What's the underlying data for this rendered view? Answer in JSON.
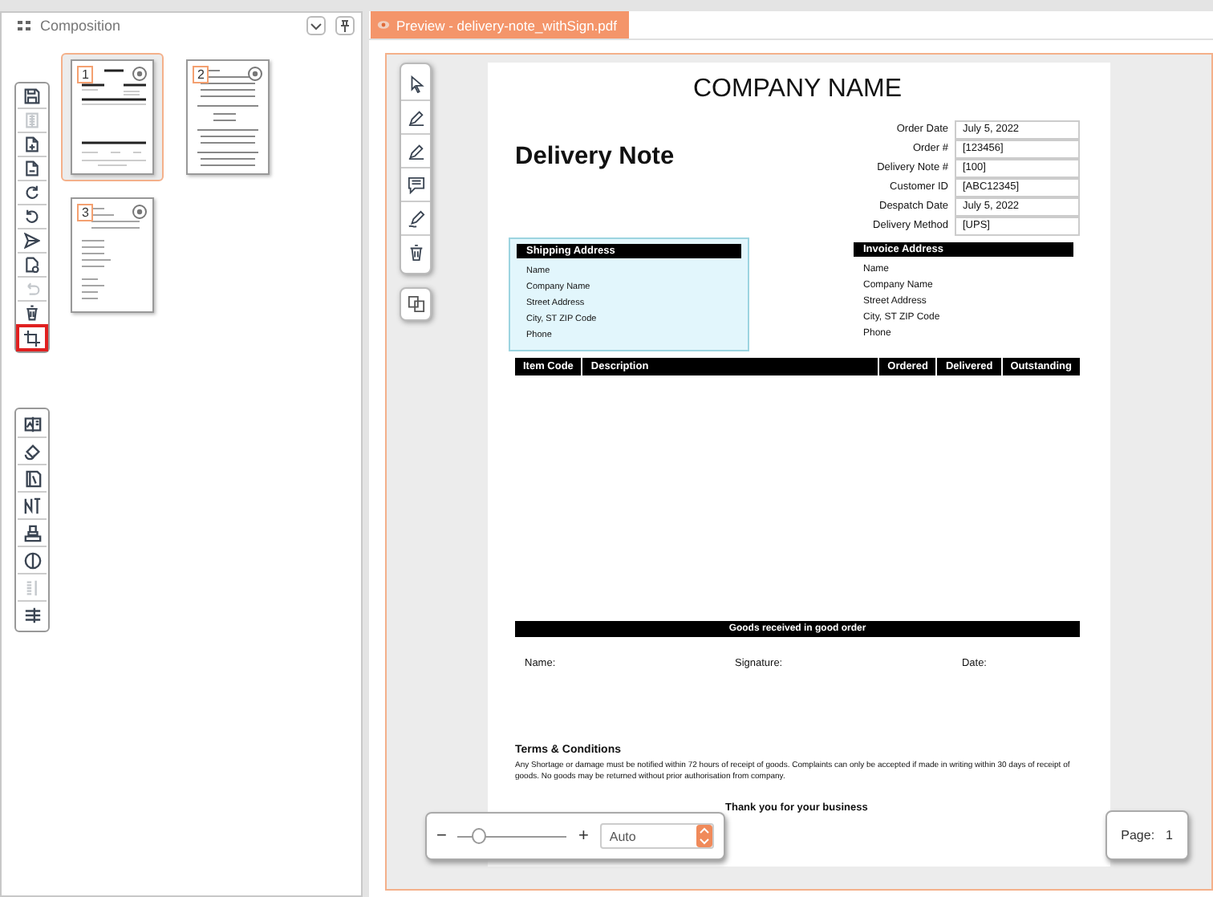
{
  "left_panel": {
    "title": "Composition",
    "toolbar": [
      {
        "disabled": false,
        "highlighted": false
      },
      {
        "disabled": true,
        "highlighted": false
      },
      {
        "disabled": false,
        "highlighted": false
      },
      {
        "disabled": false,
        "highlighted": false
      },
      {
        "disabled": false,
        "highlighted": false
      },
      {
        "disabled": false,
        "highlighted": false
      },
      {
        "disabled": false,
        "highlighted": false
      },
      {
        "disabled": false,
        "highlighted": false
      },
      {
        "disabled": true,
        "highlighted": false
      },
      {
        "disabled": false,
        "highlighted": false
      },
      {
        "disabled": false,
        "highlighted": true
      }
    ],
    "toolbar_2": [
      {
        "disabled": false
      },
      {
        "disabled": false
      },
      {
        "disabled": false
      },
      {
        "disabled": false
      },
      {
        "disabled": false
      },
      {
        "disabled": false
      },
      {
        "disabled": true
      },
      {
        "disabled": false
      }
    ],
    "thumbnails": [
      {
        "number": "1",
        "selected": true
      },
      {
        "number": "2",
        "selected": false
      },
      {
        "number": "3",
        "selected": false
      }
    ]
  },
  "tab": {
    "label": "Preview - delivery-note_withSign.pdf",
    "selected": true
  },
  "annotation_toolbar": [
    {
      "disabled": false
    },
    {
      "disabled": false
    },
    {
      "disabled": false
    },
    {
      "disabled": false
    },
    {
      "disabled": false
    },
    {
      "disabled": false
    }
  ],
  "document": {
    "company": "COMPANY NAME",
    "title": "Delivery Note",
    "fields": [
      {
        "label": "Order Date",
        "value": "July 5, 2022"
      },
      {
        "label": "Order #",
        "value": "[123456]"
      },
      {
        "label": "Delivery Note #",
        "value": "[100]"
      },
      {
        "label": "Customer ID",
        "value": "[ABC12345]"
      },
      {
        "label": "Despatch Date",
        "value": "July 5, 2022"
      },
      {
        "label": "Delivery Method",
        "value": "[UPS]"
      }
    ],
    "addresses": [
      {
        "heading": "Shipping Address",
        "highlighted": true,
        "lines": [
          "Name",
          "Company Name",
          "Street Address",
          "City, ST  ZIP Code",
          "Phone"
        ]
      },
      {
        "heading": "Invoice Address",
        "highlighted": false,
        "lines": [
          "Name",
          "Company Name",
          "Street Address",
          "City, ST  ZIP Code",
          "Phone"
        ]
      }
    ],
    "item_columns": [
      "Item Code",
      "Description",
      "Ordered",
      "Delivered",
      "Outstanding"
    ],
    "goods_heading": "Goods received in good order",
    "sign_labels": [
      "Name:",
      "Signature:",
      "Date:"
    ],
    "terms_heading": "Terms & Conditions",
    "terms_text": "Any Shortage or damage must be notified within 72 hours of receipt of goods. Complaints can only be accepted if made in writing within 30 days of receipt of goods. No goods may be returned without prior authorisation from company.",
    "thanks": "Thank you for your business"
  },
  "zoom": {
    "minus": "−",
    "plus": "+",
    "level": 0.2,
    "value": "Auto"
  },
  "page_indicator": {
    "label": "Page:",
    "value": "1"
  }
}
